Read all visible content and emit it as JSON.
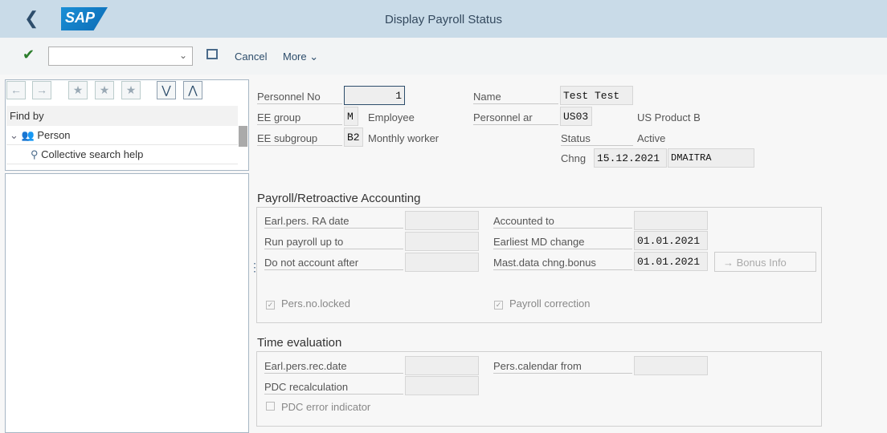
{
  "header": {
    "title": "Display Payroll Status",
    "logo": "SAP"
  },
  "toolbar": {
    "command_value": "",
    "cancel": "Cancel",
    "more": "More"
  },
  "left": {
    "find_by": "Find by",
    "tree": [
      {
        "label": "Person"
      },
      {
        "label": "Collective search help"
      }
    ]
  },
  "info": {
    "personnel_no_label": "Personnel No",
    "personnel_no": "1",
    "ee_group_label": "EE group",
    "ee_group": "M",
    "ee_group_text": "Employee",
    "ee_subgroup_label": "EE subgroup",
    "ee_subgroup": "B2",
    "ee_subgroup_text": "Monthly worker",
    "name_label": "Name",
    "name": "Test Test",
    "pers_area_label": "Personnel ar",
    "pers_area": "US03",
    "pers_area_text": "US Product B",
    "status_label": "Status",
    "status": "Active",
    "chng_label": "Chng",
    "chng_date": "15.12.2021",
    "chng_user": "DMAITRA"
  },
  "payroll": {
    "title": "Payroll/Retroactive Accounting",
    "earl_ra_label": "Earl.pers. RA date",
    "earl_ra": "",
    "run_upto_label": "Run payroll up to",
    "run_upto": "",
    "no_account_label": "Do not account after",
    "no_account": "",
    "accounted_label": "Accounted to",
    "accounted": "",
    "earliest_md_label": "Earliest MD change",
    "earliest_md": "01.01.2021",
    "mast_bonus_label": "Mast.data chng.bonus",
    "mast_bonus": "01.01.2021",
    "bonus_info": "Bonus Info",
    "locked_label": "Pers.no.locked",
    "locked": true,
    "correction_label": "Payroll correction",
    "correction": true
  },
  "time": {
    "title": "Time evaluation",
    "earl_rec_label": "Earl.pers.rec.date",
    "earl_rec": "",
    "pdc_recalc_label": "PDC recalculation",
    "pdc_recalc": "",
    "cal_from_label": "Pers.calendar from",
    "cal_from": "",
    "pdc_error_label": "PDC error indicator",
    "pdc_error": false
  }
}
